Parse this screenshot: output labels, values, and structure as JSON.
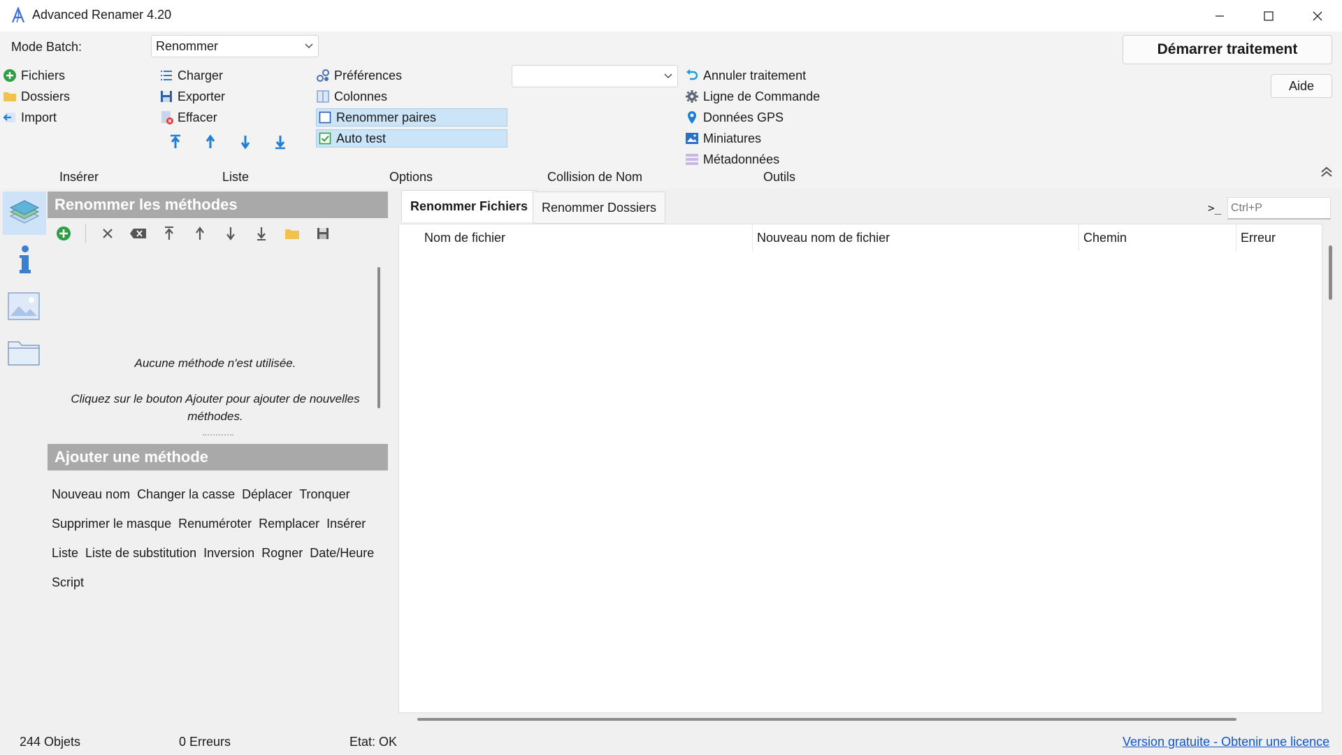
{
  "window": {
    "title": "Advanced Renamer 4.20"
  },
  "batch": {
    "label": "Mode Batch:",
    "mode_value": "Renommer"
  },
  "file_menu": [
    {
      "label": "Fichiers",
      "icon": "add-circle-icon"
    },
    {
      "label": "Dossiers",
      "icon": "folder-icon"
    },
    {
      "label": "Import",
      "icon": "import-icon"
    }
  ],
  "list_menu": [
    {
      "label": "Charger",
      "icon": "list-icon"
    },
    {
      "label": "Exporter",
      "icon": "save-icon"
    },
    {
      "label": "Effacer",
      "icon": "clear-icon"
    }
  ],
  "options_menu": [
    {
      "label": "Préférences",
      "icon": "preferences-icon"
    },
    {
      "label": "Colonnes",
      "icon": "columns-icon"
    },
    {
      "label": "Renommer paires",
      "icon": "checkbox-unchecked-icon"
    },
    {
      "label": "Auto test",
      "icon": "checkbox-checked-icon"
    }
  ],
  "tools_menu": [
    {
      "label": "Annuler traitement",
      "icon": "undo-icon"
    },
    {
      "label": "Ligne de Commande",
      "icon": "gear-icon"
    },
    {
      "label": "Données GPS",
      "icon": "location-pin-icon"
    },
    {
      "label": "Miniatures",
      "icon": "image-icon"
    },
    {
      "label": "Métadonnées",
      "icon": "metadata-icon"
    }
  ],
  "collision_select": {
    "value": ""
  },
  "buttons": {
    "start": "Démarrer traitement",
    "help": "Aide"
  },
  "section_labels": [
    "Insérer",
    "Liste",
    "Options",
    "Collision de Nom",
    "Outils"
  ],
  "methods_panel": {
    "title": "Renommer les méthodes",
    "empty_line1": "Aucune méthode n'est utilisée.",
    "empty_line2": "Cliquez sur le bouton Ajouter pour ajouter de nouvelles méthodes."
  },
  "add_method": {
    "title": "Ajouter une méthode",
    "rows": [
      [
        "Nouveau nom",
        "Changer la casse",
        "Déplacer",
        "Tronquer"
      ],
      [
        "Supprimer le masque",
        "Renuméroter",
        "Remplacer",
        "Insérer"
      ],
      [
        "Liste",
        "Liste de substitution",
        "Inversion",
        "Rogner",
        "Date/Heure"
      ],
      [
        "Script"
      ]
    ]
  },
  "tabs": {
    "files": "Renommer Fichiers",
    "folders": "Renommer Dossiers"
  },
  "command": {
    "prompt": ">_",
    "placeholder": "Ctrl+P"
  },
  "grid": {
    "columns": [
      "Nom de fichier",
      "Nouveau nom de fichier",
      "Chemin",
      "Erreur"
    ]
  },
  "status": {
    "objects": "244 Objets",
    "errors": "0 Erreurs",
    "state": "Etat: OK",
    "license_link": "Version gratuite - Obtenir une licence"
  },
  "colors": {
    "accent_blue": "#1e7fd6",
    "add_green": "#2ea043",
    "folder_yellow": "#f2c14e",
    "panel_header": "#a9a9a9",
    "highlight": "#cce4f7",
    "link": "#1155cc"
  }
}
